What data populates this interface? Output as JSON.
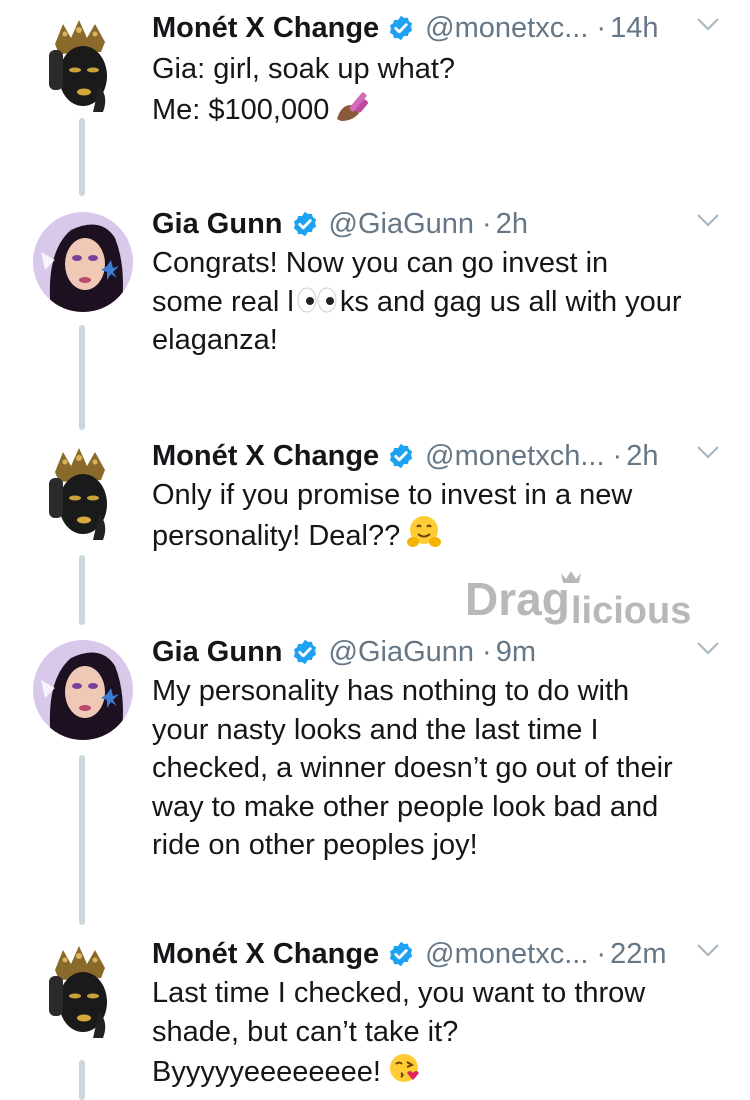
{
  "tweets": [
    {
      "author": "Monét X Change",
      "handle": "@monetxc...",
      "dot": "·",
      "time": "14h",
      "lines": [
        "Gia: girl, soak up what?",
        "Me: $100,000"
      ],
      "emoji": "nail-polish-emoji"
    },
    {
      "author": "Gia Gunn",
      "handle": "@GiaGunn",
      "dot": "·",
      "time": "2h",
      "lines": [
        "Congrats!  Now you can go invest in",
        "some real l",
        "ks and gag us all with your",
        "elaganza!"
      ],
      "emoji": "eyes-emoji"
    },
    {
      "author": "Monét X Change",
      "handle": "@monetxch...",
      "dot": "·",
      "time": "2h",
      "lines": [
        "Only if you promise to invest in a new",
        "personality! Deal??"
      ],
      "emoji": "hugging-face-emoji"
    },
    {
      "author": "Gia Gunn",
      "handle": "@GiaGunn",
      "dot": "·",
      "time": "9m",
      "lines": [
        "My personality has nothing to do with",
        "your nasty looks and the last time I",
        "checked, a winner doesn’t go out of their",
        "way to make other people look bad and",
        "ride on other peoples joy!"
      ]
    },
    {
      "author": "Monét X Change",
      "handle": "@monetxc...",
      "dot": "·",
      "time": "22m",
      "lines": [
        "Last time I checked, you want to throw",
        "shade, but can’t take it?",
        "Byyyyyeeeeeeee!"
      ],
      "emoji": "face-blowing-kiss-emoji"
    }
  ],
  "watermark": {
    "text_a": "Drag",
    "text_b": "licious"
  },
  "colors": {
    "verified": "#1da1f2",
    "thread_line": "#ccd6dd",
    "secondary_text": "#657786"
  }
}
